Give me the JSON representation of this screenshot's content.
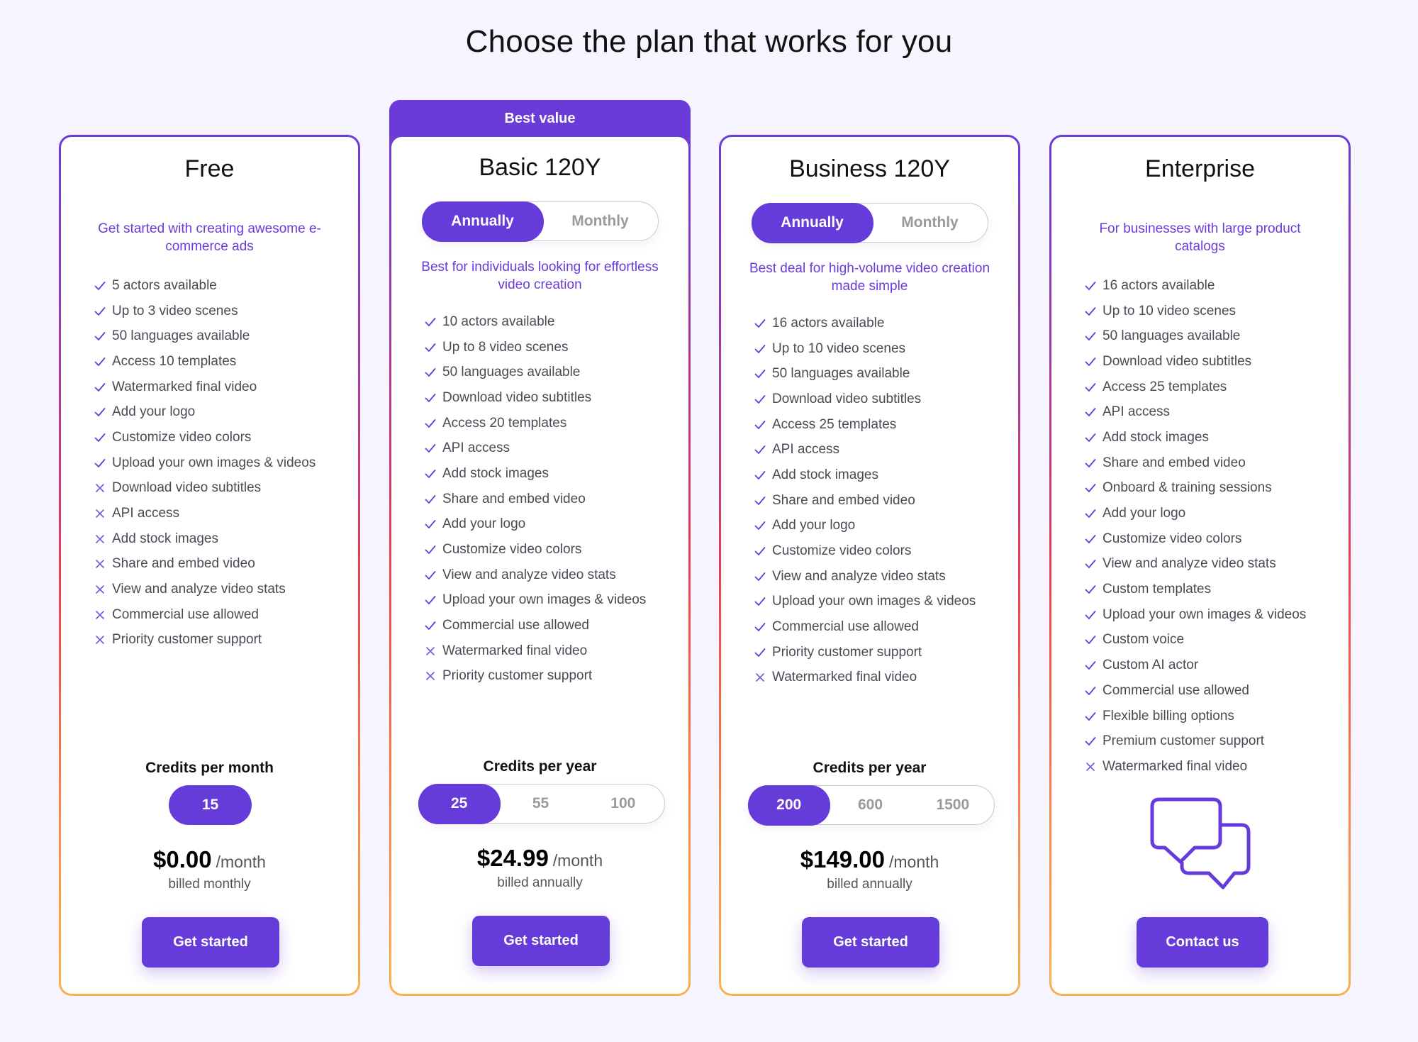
{
  "page": {
    "title": "Choose the plan that works for you"
  },
  "colors": {
    "accent": "#653bd9",
    "subtitle": "#6a3bd9",
    "background": "#f6f4fe",
    "border_top": "#6a3bd9",
    "border_bottom": "#fbb04f"
  },
  "plans": [
    {
      "name": "Free",
      "subtitle": "Get started with creating awesome e-commerce ads",
      "features": [
        {
          "label": "5 actors available",
          "included": true
        },
        {
          "label": "Up to 3 video scenes",
          "included": true
        },
        {
          "label": "50 languages available",
          "included": true
        },
        {
          "label": "Access 10 templates",
          "included": true
        },
        {
          "label": "Watermarked final video",
          "included": true
        },
        {
          "label": "Add your logo",
          "included": true
        },
        {
          "label": "Customize video colors",
          "included": true
        },
        {
          "label": "Upload your own images & videos",
          "included": true
        },
        {
          "label": "Download video subtitles",
          "included": false
        },
        {
          "label": "API access",
          "included": false
        },
        {
          "label": "Add stock images",
          "included": false
        },
        {
          "label": "Share and embed video",
          "included": false
        },
        {
          "label": "View and analyze video stats",
          "included": false
        },
        {
          "label": "Commercial use allowed",
          "included": false
        },
        {
          "label": "Priority customer support",
          "included": false
        }
      ],
      "credits_label": "Credits per month",
      "credit_options": [
        "15"
      ],
      "credit_selected": "15",
      "price": "$0.00",
      "per": "/month",
      "billed": "billed monthly",
      "cta": "Get started"
    },
    {
      "name": "Basic 120Y",
      "banner": "Best value",
      "toggle": {
        "options": [
          "Annually",
          "Monthly"
        ],
        "selected": "Annually"
      },
      "subtitle": "Best for individuals looking for effortless video creation",
      "features": [
        {
          "label": "10 actors available",
          "included": true
        },
        {
          "label": "Up to 8 video scenes",
          "included": true
        },
        {
          "label": "50 languages available",
          "included": true
        },
        {
          "label": "Download video subtitles",
          "included": true
        },
        {
          "label": "Access 20 templates",
          "included": true
        },
        {
          "label": "API access",
          "included": true
        },
        {
          "label": "Add stock images",
          "included": true
        },
        {
          "label": "Share and embed video",
          "included": true
        },
        {
          "label": "Add your logo",
          "included": true
        },
        {
          "label": "Customize video colors",
          "included": true
        },
        {
          "label": "View and analyze video stats",
          "included": true
        },
        {
          "label": "Upload your own images & videos",
          "included": true
        },
        {
          "label": "Commercial use allowed",
          "included": true
        },
        {
          "label": "Watermarked final video",
          "included": false
        },
        {
          "label": "Priority customer support",
          "included": false
        }
      ],
      "credits_label": "Credits per year",
      "credit_options": [
        "25",
        "55",
        "100"
      ],
      "credit_selected": "25",
      "price": "$24.99",
      "per": "/month",
      "billed": "billed annually",
      "cta": "Get started"
    },
    {
      "name": "Business 120Y",
      "toggle": {
        "options": [
          "Annually",
          "Monthly"
        ],
        "selected": "Annually"
      },
      "subtitle": "Best deal for high-volume video creation made simple",
      "features": [
        {
          "label": "16 actors available",
          "included": true
        },
        {
          "label": "Up to 10 video scenes",
          "included": true
        },
        {
          "label": "50 languages available",
          "included": true
        },
        {
          "label": "Download video subtitles",
          "included": true
        },
        {
          "label": "Access 25 templates",
          "included": true
        },
        {
          "label": "API access",
          "included": true
        },
        {
          "label": "Add stock images",
          "included": true
        },
        {
          "label": "Share and embed video",
          "included": true
        },
        {
          "label": "Add your logo",
          "included": true
        },
        {
          "label": "Customize video colors",
          "included": true
        },
        {
          "label": "View and analyze video stats",
          "included": true
        },
        {
          "label": "Upload your own images & videos",
          "included": true
        },
        {
          "label": "Commercial use allowed",
          "included": true
        },
        {
          "label": "Priority customer support",
          "included": true
        },
        {
          "label": "Watermarked final video",
          "included": false
        }
      ],
      "credits_label": "Credits per year",
      "credit_options": [
        "200",
        "600",
        "1500"
      ],
      "credit_selected": "200",
      "price": "$149.00",
      "per": "/month",
      "billed": "billed annually",
      "cta": "Get started"
    },
    {
      "name": "Enterprise",
      "subtitle": "For businesses with large product catalogs",
      "features": [
        {
          "label": "16 actors available",
          "included": true
        },
        {
          "label": "Up to 10 video scenes",
          "included": true
        },
        {
          "label": "50 languages available",
          "included": true
        },
        {
          "label": "Download video subtitles",
          "included": true
        },
        {
          "label": "Access 25 templates",
          "included": true
        },
        {
          "label": "API access",
          "included": true
        },
        {
          "label": "Add stock images",
          "included": true
        },
        {
          "label": "Share and embed video",
          "included": true
        },
        {
          "label": "Onboard & training sessions",
          "included": true
        },
        {
          "label": "Add your logo",
          "included": true
        },
        {
          "label": "Customize video colors",
          "included": true
        },
        {
          "label": "View and analyze video stats",
          "included": true
        },
        {
          "label": "Custom templates",
          "included": true
        },
        {
          "label": "Upload your own images & videos",
          "included": true
        },
        {
          "label": "Custom voice",
          "included": true
        },
        {
          "label": "Custom AI actor",
          "included": true
        },
        {
          "label": "Commercial use allowed",
          "included": true
        },
        {
          "label": "Flexible billing options",
          "included": true
        },
        {
          "label": "Premium customer support",
          "included": true
        },
        {
          "label": "Watermarked final video",
          "included": false
        }
      ],
      "icon": "chat-bubbles-icon",
      "cta": "Contact us"
    }
  ]
}
